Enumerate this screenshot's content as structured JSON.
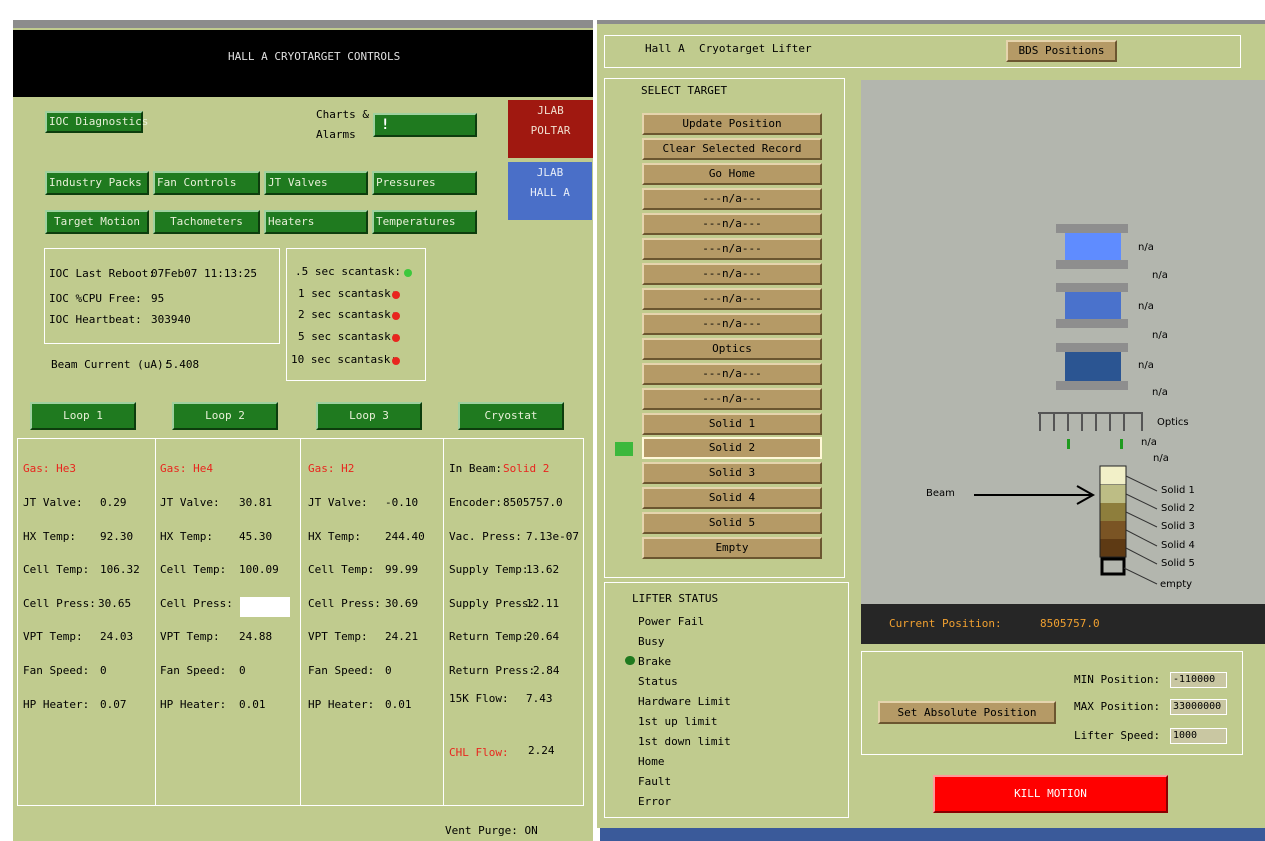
{
  "left": {
    "title": "HALL A CRYOTARGET CONTROLS",
    "ioc_diag": "IOC Diagnostics",
    "charts_alarms": [
      "Charts &",
      "Alarms"
    ],
    "charts_btn": "!",
    "jlab_poltar": [
      "JLAB",
      "POLTAR"
    ],
    "jlab_halla": [
      "JLAB",
      "HALL A"
    ],
    "menu_row1": [
      "Industry Packs",
      "Fan Controls",
      "JT Valves",
      "Pressures"
    ],
    "menu_row2": [
      "Target Motion",
      "Tachometers",
      "Heaters",
      "Temperatures"
    ],
    "ioc": {
      "reboot_label": "IOC Last Reboot:",
      "reboot_value": "07Feb07 11:13:25",
      "cpu_label": "IOC %CPU Free:",
      "cpu_value": "95",
      "heartbeat_label": "IOC Heartbeat:",
      "heartbeat_value": "303940"
    },
    "scantasks": [
      ".5 sec scantask:",
      "1 sec scantask:",
      "2 sec scantask:",
      "5 sec scantask:",
      "10 sec scantask:"
    ],
    "beam_current_label": "Beam Current (uA):",
    "beam_current_value": "5.408",
    "loops": [
      "Loop 1",
      "Loop 2",
      "Loop 3",
      "Cryostat"
    ],
    "row_labels": [
      "JT Valve:",
      "HX Temp:",
      "Cell Temp:",
      "Cell Press:",
      "VPT Temp:",
      "Fan Speed:",
      "HP Heater:"
    ],
    "loop1": {
      "gas": "Gas: He3",
      "values": [
        "0.29",
        "92.30",
        "106.32",
        "30.65",
        "24.03",
        "0",
        "0.07"
      ]
    },
    "loop2": {
      "gas": "Gas: He4",
      "values": [
        "30.81",
        "45.30",
        "100.09",
        "",
        "24.88",
        "0",
        "0.01"
      ]
    },
    "loop3": {
      "gas": "Gas: H2",
      "values": [
        "-0.10",
        "244.40",
        "99.99",
        "30.69",
        "24.21",
        "0",
        "0.01"
      ]
    },
    "cryostat": {
      "in_beam_label": "In Beam:",
      "in_beam_value": "Solid 2",
      "rows": [
        [
          "Encoder:",
          "8505757.0"
        ],
        [
          "Vac. Press:",
          "7.13e-07"
        ],
        [
          "Supply Temp:",
          "13.62"
        ],
        [
          "Supply Press:",
          "12.11"
        ],
        [
          "Return Temp:",
          "20.64"
        ],
        [
          "Return Press:",
          "2.84"
        ],
        [
          "15K Flow:",
          "7.43"
        ]
      ],
      "chl_label": "CHL Flow:",
      "chl_value": "2.24"
    },
    "vent_purge": "Vent Purge: ON"
  },
  "right": {
    "title1": "Hall A",
    "title2": "Cryotarget Lifter",
    "bds_button": "BDS Positions",
    "select_target": "SELECT TARGET",
    "targets": [
      "Update Position",
      "Clear Selected Record",
      "Go Home",
      "---n/a---",
      "---n/a---",
      "---n/a---",
      "---n/a---",
      "---n/a---",
      "---n/a---",
      "Optics",
      "---n/a---",
      "---n/a---",
      "Solid 1",
      "Solid 2",
      "Solid 3",
      "Solid 4",
      "Solid 5",
      "Empty"
    ],
    "lifter_status": "LIFTER STATUS",
    "status_items": [
      "Power Fail",
      "Busy",
      "Brake",
      "Status",
      "Hardware Limit",
      "1st up limit",
      "1st down limit",
      "Home",
      "Fault",
      "Error"
    ],
    "diagram": {
      "na_labels": [
        "n/a",
        "n/a",
        "n/a",
        "n/a",
        "n/a",
        "n/a",
        "n/a",
        "n/a"
      ],
      "optics": "Optics",
      "beam": "Beam",
      "solid_labels": [
        "Solid 1",
        "Solid 2",
        "Solid 3",
        "Solid 4",
        "Solid 5",
        "empty"
      ]
    },
    "current_position_label": "Current Position:",
    "current_position_value": "8505757.0",
    "set_abs_button": "Set Absolute Position",
    "min_label": "MIN Position:",
    "min_value": "-110000",
    "max_label": "MAX Position:",
    "max_value": "33000000",
    "speed_label": "Lifter Speed:",
    "speed_value": "1000",
    "kill_button": "KILL MOTION"
  },
  "colors": {
    "panel": "#c0cb8e",
    "green_button": "#1f7a1f",
    "tan_button": "#b59a66",
    "kill": "#ff0000",
    "poltar": "#a01810",
    "halla": "#4a6fc8",
    "alarm_red": "#e8261e",
    "ok_green": "#3cc83c"
  }
}
